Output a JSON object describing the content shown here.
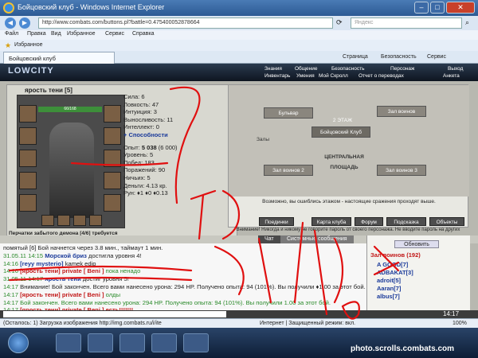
{
  "window": {
    "title": "Бойцовский клуб - Windows Internet Explorer"
  },
  "address": {
    "url": "http://www.combats.com/buttons.pl?battle=0.475400052878664",
    "search_placeholder": "Яндекс"
  },
  "menu": [
    "Файл",
    "Правка",
    "Вид",
    "Избранное",
    "Сервис",
    "Справка"
  ],
  "favorites": {
    "label": "Избранное"
  },
  "tab": {
    "label": "Бойцовский клуб"
  },
  "commandbar": [
    "Страница",
    "Безопасность",
    "Сервис"
  ],
  "game": {
    "logo": "LOWCITY",
    "top_menu": [
      "Знания",
      "Общение",
      "Безопасность",
      "Персонаж",
      "Выход"
    ],
    "sub_menu": [
      "Инвентарь",
      "Умения",
      "Мой Скролл",
      "Отчет о переводах",
      "Анкета"
    ],
    "character": {
      "name": "ярость тени [5]",
      "hp": "66/168",
      "item_title": "Перчатки забытого демона [4/6] требуется ремонт",
      "stats": [
        "Сила: 6",
        "Ловкость: 47",
        "Интуиция: 3",
        "Выносливость: 11",
        "Интеллект: 0"
      ],
      "skills_link": "+ Способности",
      "exp_label": "Опыт:",
      "exp_value": "5 038",
      "exp_next": "(6 000)",
      "info": [
        "Уровень: 5",
        "Побед: 183",
        "Поражений: 90",
        "Ничьих: 5"
      ],
      "money_label": "Деньги:",
      "money_value": "4.13 кр.",
      "rep": "Рун: ♦1 ♦0 ♦0.13"
    },
    "map": {
      "labels": [
        "Бульвар",
        "Зал воинов",
        "Залы",
        "Бойцовский Клуб",
        "2 ЭТАЖ",
        "Зал воинов 2",
        "Зал воинов 3",
        "ЦЕНТРАЛЬНАЯ ПЛОЩАДЬ"
      ],
      "note": "Возможно, вы ошиблись этажом - настоящие сражения проходят выше.",
      "buttons": [
        "Поединки",
        "Карта клуба",
        "Форум",
        "Подсказка",
        "Объекты"
      ]
    },
    "warning": "Внимание! Никогда и никому не говорите пароль от своего персонажа. Не вводите пароль на других",
    "chat_tabs": [
      "Чат",
      "Системные сообщения"
    ],
    "chat": [
      [
        {
          "c": "first",
          "t": "помятый [6] Бой начнется через 3.8 мин., таймаут 1 мин."
        }
      ],
      [
        {
          "c": "tm",
          "t": "31.05.11 14:15 "
        },
        {
          "c": "nm",
          "t": "Морской бриз"
        },
        {
          "c": "first",
          "t": " достигла уровня 4!"
        }
      ],
      [
        {
          "c": "tm",
          "t": "14:16 "
        },
        {
          "c": "nm",
          "t": "[reyy mysterio]"
        },
        {
          "c": "first",
          "t": " kamek edip"
        }
      ],
      [
        {
          "c": "tm",
          "t": "14:16 "
        },
        {
          "c": "pv",
          "t": "[ярость тени] private [ Beni ]"
        },
        {
          "c": "gr",
          "t": " пока ненадо"
        }
      ],
      [
        {
          "c": "tm",
          "t": "31.05.11 14:17 "
        },
        {
          "c": "nm",
          "t": "ярость тени"
        },
        {
          "c": "first",
          "t": " достиг уровня 5!"
        }
      ],
      [
        {
          "c": "tm",
          "t": "14:17 "
        },
        {
          "c": "first",
          "t": "Внимание! Бой закончен. Всего вами нанесено урона: 294 HP. Получено опыта: 94 (101%). Вы получили ♦1.00 за этот бой."
        }
      ],
      [
        {
          "c": "tm",
          "t": "14:17 "
        },
        {
          "c": "pv",
          "t": "[ярость тени] private [ Beni ]"
        },
        {
          "c": "gr",
          "t": " олды"
        }
      ],
      [
        {
          "c": "tm",
          "t": "14:17 "
        },
        {
          "c": "gr",
          "t": "Бой закончен. Всего вами нанесено урона: 294 HP. Получено опыта: 94 (101%). Вы получили 1.00 за этот бой."
        }
      ],
      [
        {
          "c": "tm",
          "t": "14:17 "
        },
        {
          "c": "pv",
          "t": "[ярость тени] private [ Beni ]"
        },
        {
          "c": "pv",
          "t": " есть!!!!!!!"
        }
      ]
    ],
    "online": {
      "refresh": "Обновить",
      "title": "Зал воинов (192)",
      "users": [
        "A GOOD[7]",
        "ADBAKAT[3]",
        "adroit[5]",
        "Aaran[7]",
        "albus[7]"
      ]
    },
    "clock": "14:17"
  },
  "status": {
    "left": "(Осталось: 1) Загрузка изображения http://img.combats.ru/i/ite",
    "zone": "Интернет | Защищенный режим: вкл.",
    "zoom": "100%"
  },
  "watermark": "photo.scrolls.combats.com",
  "scrawl": {
    "text": "ЗА СУТКИ :-)",
    "color": "#e01010"
  }
}
